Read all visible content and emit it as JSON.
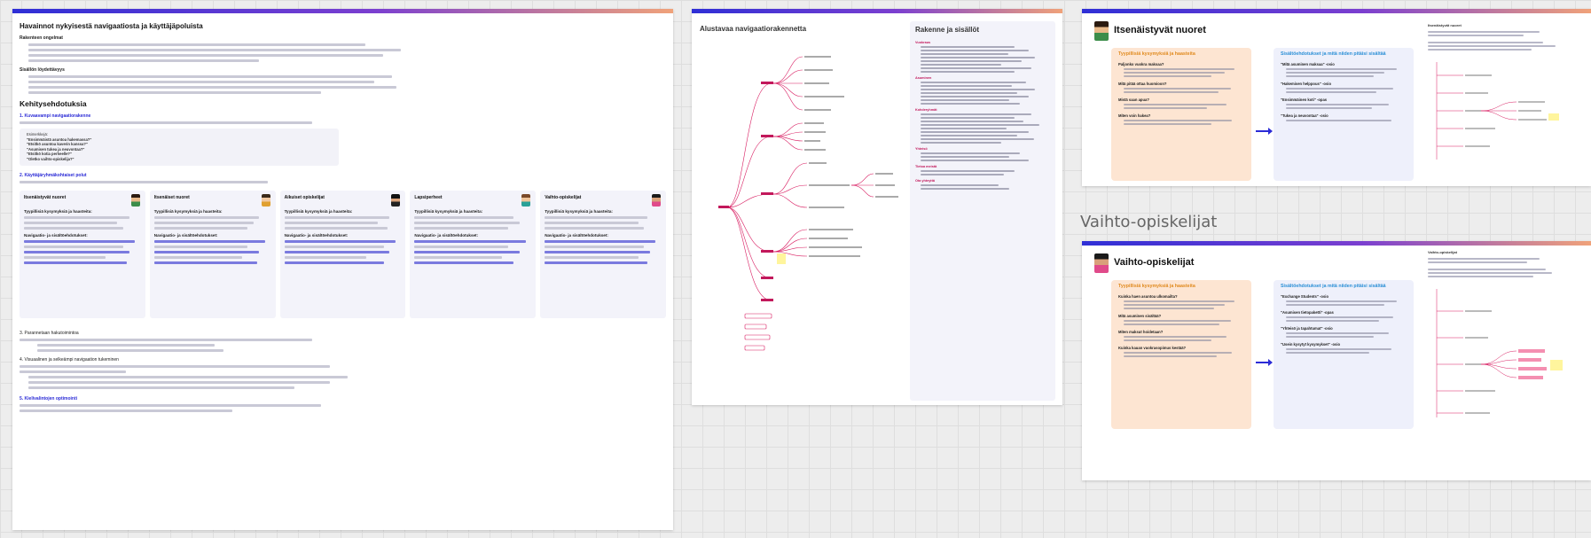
{
  "board1": {
    "title": "Havainnot nykyisestä navigaatiosta ja käyttäjäpoluista",
    "section1_title": "Rakenteen ongelmat",
    "section2_title": "Sisällön löydettävyys",
    "dev_title": "Kehitysehdotuksia",
    "dev1_title": "1. Kuvaavampi navigaatiorakenne",
    "examples_label": "Esimerkkejä:",
    "examples": [
      "\"Ensimmäistä asuntoa hakemassa?\"",
      "\"Etsitkö asuntoa kaverin kanssa?\"",
      "\"Asumisen tukea ja neuvontaa?\"",
      "\"Etsitkö kotia perheelle?\"",
      "\"Oletko vaihto-opiskelija?\""
    ],
    "dev2_title": "2. Käyttäjäryhmäkohtaiset polut",
    "personas": [
      {
        "title": "Itsenäistyvät nuoret",
        "sub1": "Tyypillisiä kysymyksiä ja haasteita:",
        "sub2": "Navigaatio- ja sisältöehdotukset:"
      },
      {
        "title": "Itsenäiset nuoret",
        "sub1": "Tyypillisiä kysymyksiä ja haasteita:",
        "sub2": "Navigaatio- ja sisältöehdotukset:"
      },
      {
        "title": "Aikuiset opiskelijat",
        "sub1": "Tyypillisiä kysymyksiä ja haasteita:",
        "sub2": "Navigaatio- ja sisältöehdotukset:"
      },
      {
        "title": "Lapsiperheet",
        "sub1": "Tyypillisiä kysymyksiä ja haasteita:",
        "sub2": "Navigaatio- ja sisältöehdotukset:"
      },
      {
        "title": "Vaihto-opiskelijat",
        "sub1": "Tyypillisiä kysymyksiä ja haasteita:",
        "sub2": "Navigaatio- ja sisältöehdotukset:"
      }
    ],
    "dev3_title": "3. Parannetaan hakutoimintoa",
    "dev4_title": "4. Visuaalinen ja selkeämpi navigaation tukeminen",
    "dev5_title": "5. Kielivalintojen optimointi"
  },
  "board2": {
    "title": "Alustavaa navigaatiorakennetta",
    "panel_title": "Rakenne ja sisällöt",
    "root_label": "Etusivu",
    "categories": [
      "Vuokraus",
      "Asuminen",
      "Kohderyhmät",
      "Yhteisö",
      "Tietoa meistä",
      "Ota yhteyttä"
    ]
  },
  "board3": {
    "title": "Itsenäistyvät nuoret",
    "col1_title": "Tyypillisiä kysymyksiä ja haasteita",
    "col2_title": "Sisältöehdotukset ja mitä niiden pitäisi sisältää",
    "questions": [
      "Paljonko vuokra maksaa?",
      "Mitä pitää ottaa huomioon?",
      "Mistä saan apua?",
      "Miten voin hakea?"
    ],
    "suggestions": [
      "\"Mitä asuminen maksaa\" -osio",
      "\"Hakemisen helppous\" -osio",
      "\"Ensimmäinen koti\" -opas",
      "\"Tukea ja neuvontaa\" -osio"
    ],
    "side_title": "Itsenäistyvät nuoret"
  },
  "board4": {
    "floating_label": "Vaihto-opiskelijat",
    "title": "Vaihto-opiskelijat",
    "col1_title": "Tyypillisiä kysymyksiä ja haasteita",
    "col2_title": "Sisältöehdotukset ja mitä niiden pitäisi sisältää",
    "questions": [
      "Kuinka haen asuntoa ulkomailta?",
      "Mitä asuminen sisältää?",
      "Miten maksut hoidetaan?",
      "Kuinka kauan vuokrasopimus kestää?"
    ],
    "suggestions": [
      "\"Exchange Students\" -osio",
      "\"Asumisen tietopaketti\" -opas",
      "\"Yhteisö ja tapahtumat\" -osio",
      "\"Usein kysytyt kysymykset\" -osio"
    ],
    "side_title": "Vaihto-opiskelijat"
  }
}
